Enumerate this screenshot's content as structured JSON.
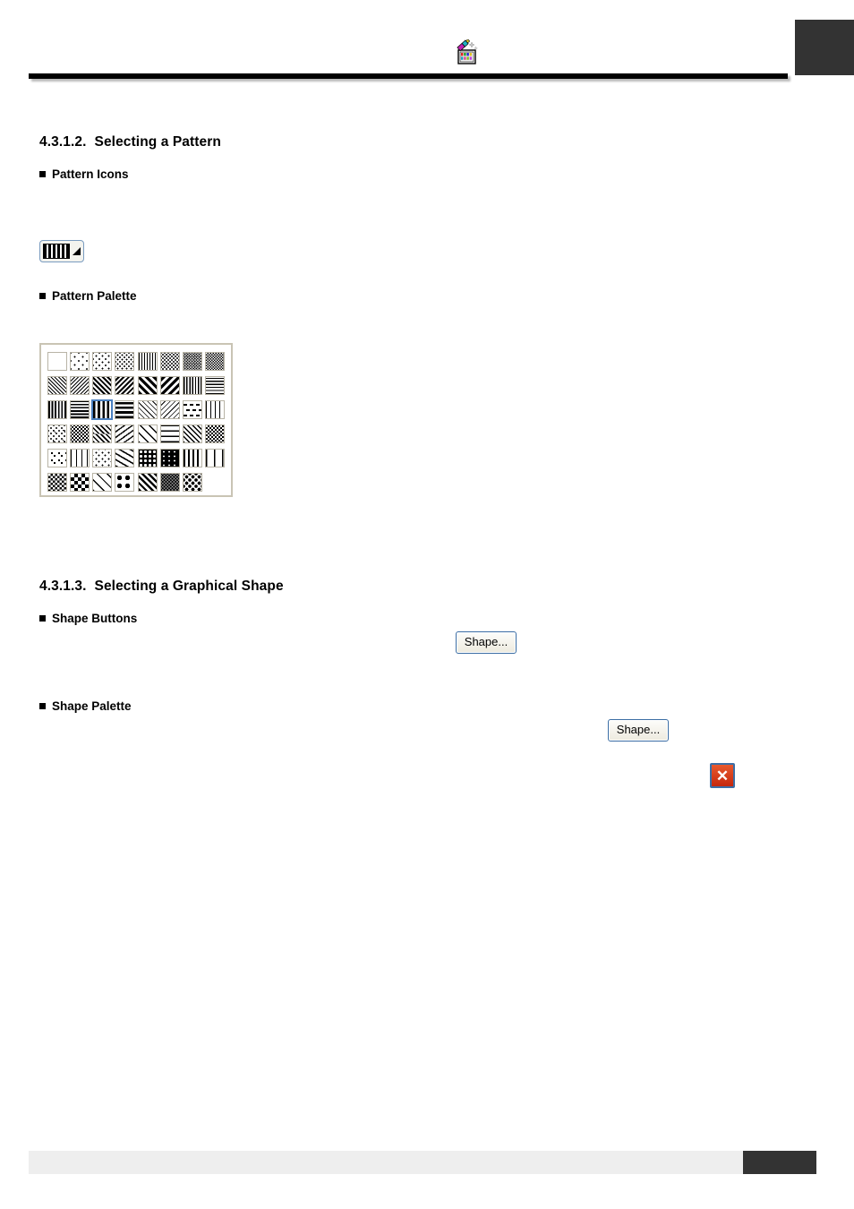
{
  "page": {
    "header_icon": "color-palette-wand-icon",
    "corner_block": "page-corner-marker"
  },
  "sections": [
    {
      "number": "4.3.1.2.",
      "title": "Selecting a Pattern",
      "subsections": [
        {
          "label": "Pattern Icons"
        },
        {
          "label": "Pattern Palette"
        }
      ]
    },
    {
      "number": "4.3.1.3.",
      "title": "Selecting a Graphical Shape",
      "subsections": [
        {
          "label": "Shape Buttons"
        },
        {
          "label": "Shape Palette"
        }
      ]
    }
  ],
  "pattern_icon_button": {
    "name": "pattern-dropdown-button",
    "swatch": "vertical-stripes",
    "dropdown_indicator": "triangle"
  },
  "pattern_palette": {
    "columns": 8,
    "rows": 6,
    "selected_index": 18,
    "selected_border_color": "#4a80c0",
    "border_color": "#c9c4b4",
    "swatches": [
      "solid-white",
      "sparse-dots-5",
      "dots-10",
      "dots-20",
      "dots-25-vertical",
      "dots-30",
      "dots-40",
      "dots-50",
      "diagonal-thin-left",
      "diagonal-thin-right",
      "diagonal-wide-left",
      "diagonal-wide-right",
      "diagonal-bold-left",
      "diagonal-bold-right",
      "vertical-thin",
      "horizontal-thin",
      "vertical-medium",
      "horizontal-medium",
      "vertical-bold",
      "horizontal-bold",
      "diagonal-light-left",
      "diagonal-light-right",
      "dashed-horizontal",
      "dotted-grid",
      "speckle-light",
      "speckle-dense",
      "zigzag",
      "wave",
      "lattice-diagonal",
      "brick",
      "herringbone",
      "weave-dense",
      "scattered-dots",
      "cross-dashes",
      "sparse-specks",
      "curls",
      "large-dots-dark",
      "ovals-dark",
      "grid-bold",
      "grid-thin",
      "checker-small",
      "checker-large",
      "diamond-outline",
      "diamond-dots",
      "diamond-dense",
      "dots-diamond-mix",
      "plus-dots",
      "empty"
    ]
  },
  "shape_buttons": [
    {
      "name": "shape-button-primary",
      "label": "Shape..."
    },
    {
      "name": "shape-button-secondary",
      "label": "Shape..."
    }
  ],
  "close_button": {
    "name": "close-button",
    "glyph": "✕",
    "color": "#d8381a",
    "border_color": "#3c6ea5"
  },
  "footer": {
    "bar_color": "#eeeeee",
    "block_color": "#333333"
  }
}
